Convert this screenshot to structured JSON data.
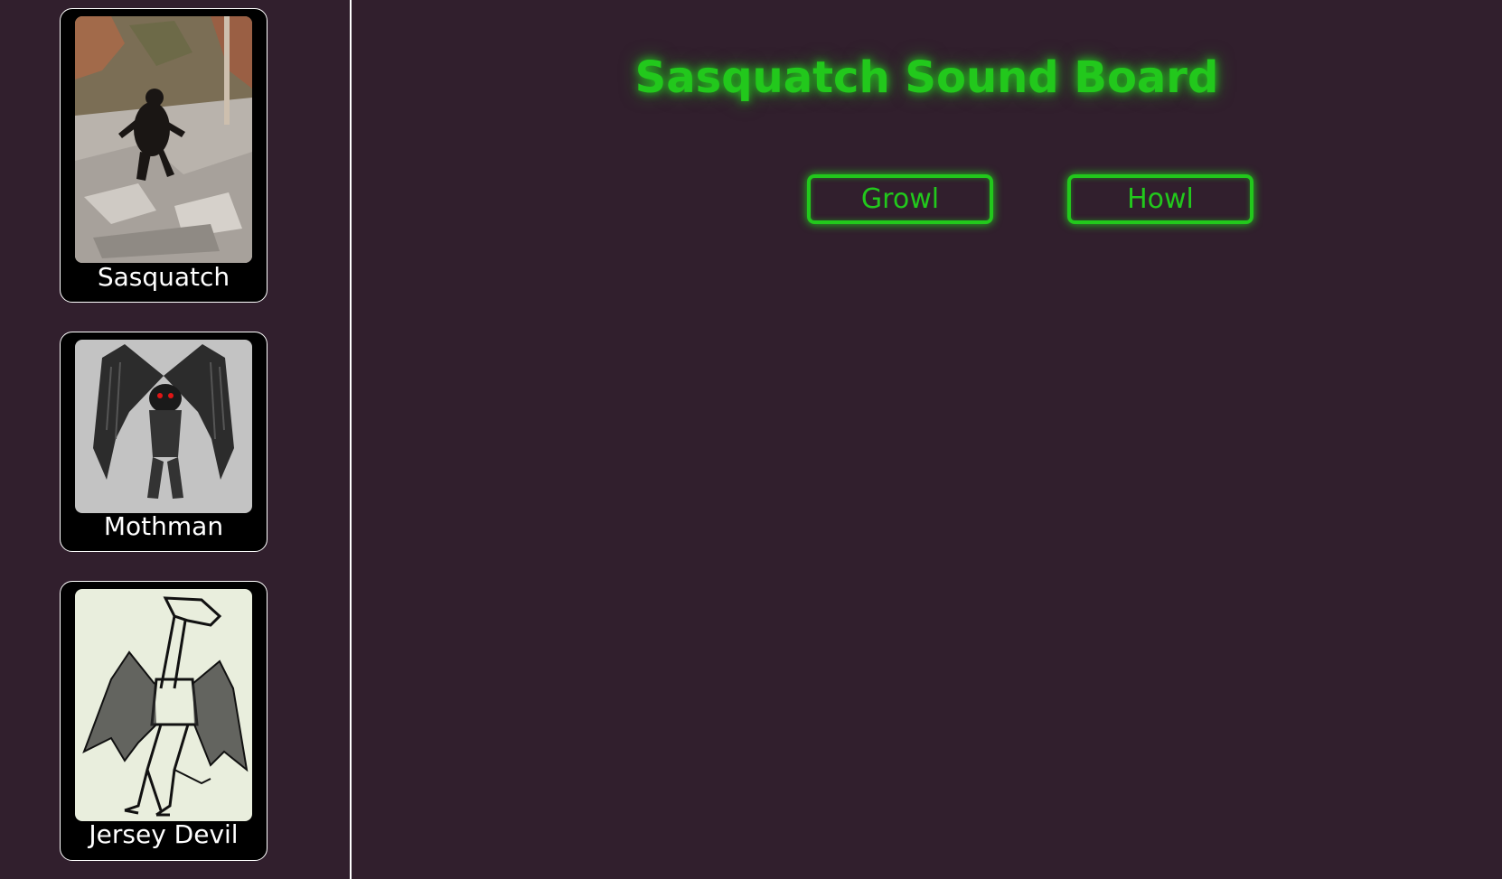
{
  "page": {
    "title": "Sasquatch Sound Board"
  },
  "sidebar": {
    "cards": [
      {
        "name": "Sasquatch",
        "image": "sasquatch-photo"
      },
      {
        "name": "Mothman",
        "image": "mothman-drawing"
      },
      {
        "name": "Jersey Devil",
        "image": "jersey-devil-drawing"
      }
    ]
  },
  "buttons": [
    {
      "label": "Growl"
    },
    {
      "label": "Howl"
    }
  ],
  "colors": {
    "background": "#311f2d",
    "accent": "#22c81c",
    "card_background": "#000000",
    "card_border": "#ffffff"
  }
}
